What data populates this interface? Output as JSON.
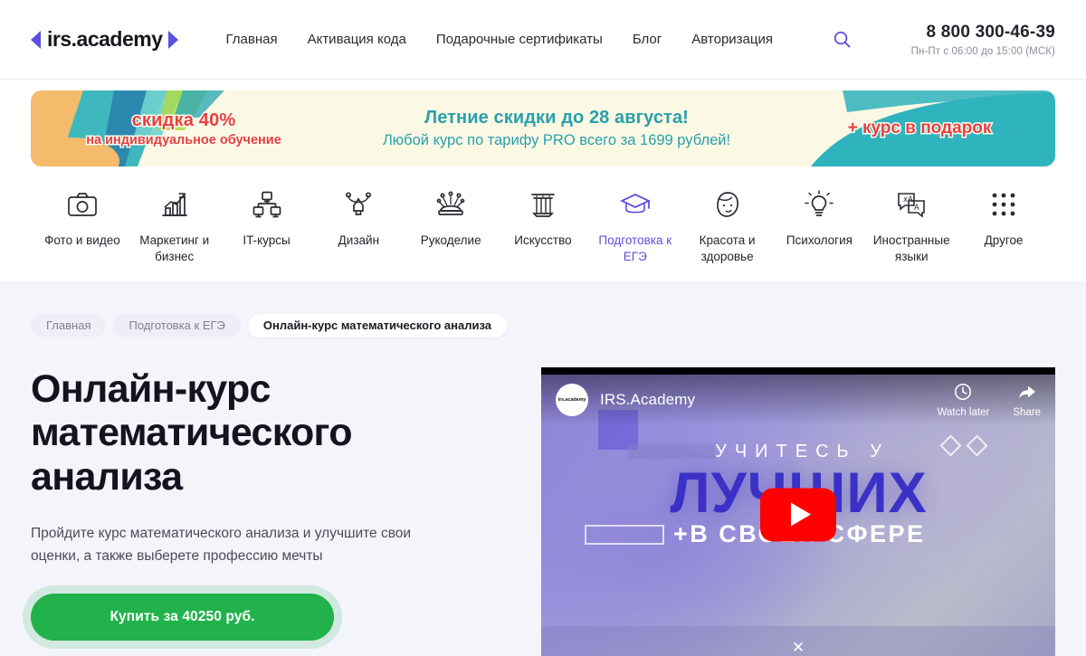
{
  "header": {
    "logo_text": "irs.academy",
    "nav": [
      {
        "label": "Главная"
      },
      {
        "label": "Активация кода"
      },
      {
        "label": "Подарочные сертификаты"
      },
      {
        "label": "Блог"
      },
      {
        "label": "Авторизация"
      }
    ],
    "search_icon": "search-icon",
    "phone": "8 800 300-46-39",
    "hours": "Пн-Пт с 06:00 до 15:00 (МСК)"
  },
  "promo": {
    "left_line1": "скидка 40%",
    "left_line2": "на индивидуальное обучение",
    "center_line1": "Летние скидки до 28 августа!",
    "center_line2": "Любой курс по тарифу PRO всего за 1699 рублей!",
    "right_line1": "+ курс в подарок",
    "colors": {
      "bg": "#fbf8e3",
      "teal": "#2aa0ad",
      "red": "#e8403f",
      "orange": "#f0b45a"
    }
  },
  "categories": [
    {
      "label": "Фото и видео",
      "icon": "camera-icon",
      "active": false
    },
    {
      "label": "Маркетинг и бизнес",
      "icon": "bar-chart-arrow-icon",
      "active": false
    },
    {
      "label": "IT-курсы",
      "icon": "network-monitors-icon",
      "active": false
    },
    {
      "label": "Дизайн",
      "icon": "pen-tool-icon",
      "active": false
    },
    {
      "label": "Рукоделие",
      "icon": "pin-cushion-icon",
      "active": false
    },
    {
      "label": "Искусство",
      "icon": "column-icon",
      "active": false
    },
    {
      "label": "Подготовка к ЕГЭ",
      "icon": "graduation-cap-icon",
      "active": true
    },
    {
      "label": "Красота и здоровье",
      "icon": "face-icon",
      "active": false
    },
    {
      "label": "Психология",
      "icon": "lightbulb-icon",
      "active": false
    },
    {
      "label": "Иностранные языки",
      "icon": "translate-icon",
      "active": false
    },
    {
      "label": "Другое",
      "icon": "grid-dots-icon",
      "active": false
    }
  ],
  "breadcrumbs": [
    {
      "label": "Главная",
      "current": false
    },
    {
      "label": "Подготовка к ЕГЭ",
      "current": false
    },
    {
      "label": "Онлайн-курс математического анализа",
      "current": true
    }
  ],
  "hero": {
    "title_line1": "Онлайн-курс",
    "title_line2": "математического",
    "title_line3": "анализа",
    "subtitle": "Пройдите курс математического анализа и улучшите свои оценки, а также выберете профессию мечты",
    "cta_label": "Купить за 40250 руб.",
    "cta_color": "#22b24c"
  },
  "video": {
    "avatar_label": "irs.academy",
    "channel": "IRS.Academy",
    "watch_later_label": "Watch later",
    "watch_later_icon": "clock-icon",
    "share_label": "Share",
    "share_icon": "share-arrow-icon",
    "play_icon": "youtube-play-icon",
    "close_icon": "close-icon",
    "thumb_line1": "УЧИТЕСЬ У",
    "thumb_line2": "ЛУЧШИХ",
    "thumb_line3": "+В СВОЕЙ СФЕРЕ"
  }
}
